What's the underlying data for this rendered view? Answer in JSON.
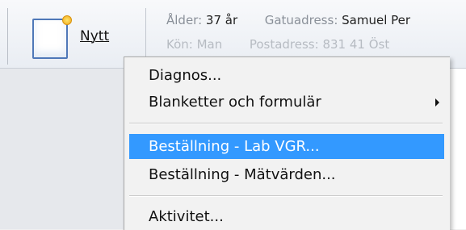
{
  "toolbar": {
    "new_button_label": "Nytt",
    "patient": {
      "age_label": "Ålder:",
      "age_value": "37 år",
      "address_label": "Gatuadress:",
      "address_value": "Samuel Per",
      "gender_label": "Kön:",
      "gender_value": "Man",
      "postal_label": "Postadress:",
      "postal_value": "831 41 Öst"
    }
  },
  "menu": {
    "items": [
      {
        "label": "Diagnos..."
      },
      {
        "label": "Blanketter och formulär",
        "submenu": true
      },
      {
        "label": "Beställning - Lab VGR...",
        "highlighted": true
      },
      {
        "label": "Beställning - Mätvärden..."
      },
      {
        "label": "Aktivitet..."
      }
    ]
  },
  "colors": {
    "highlight": "#3399ff",
    "menu_background": "#f2f2f2",
    "toolbar_background": "#eef1f5"
  },
  "icons": [
    "new-document-icon",
    "submenu-arrow-icon"
  ]
}
